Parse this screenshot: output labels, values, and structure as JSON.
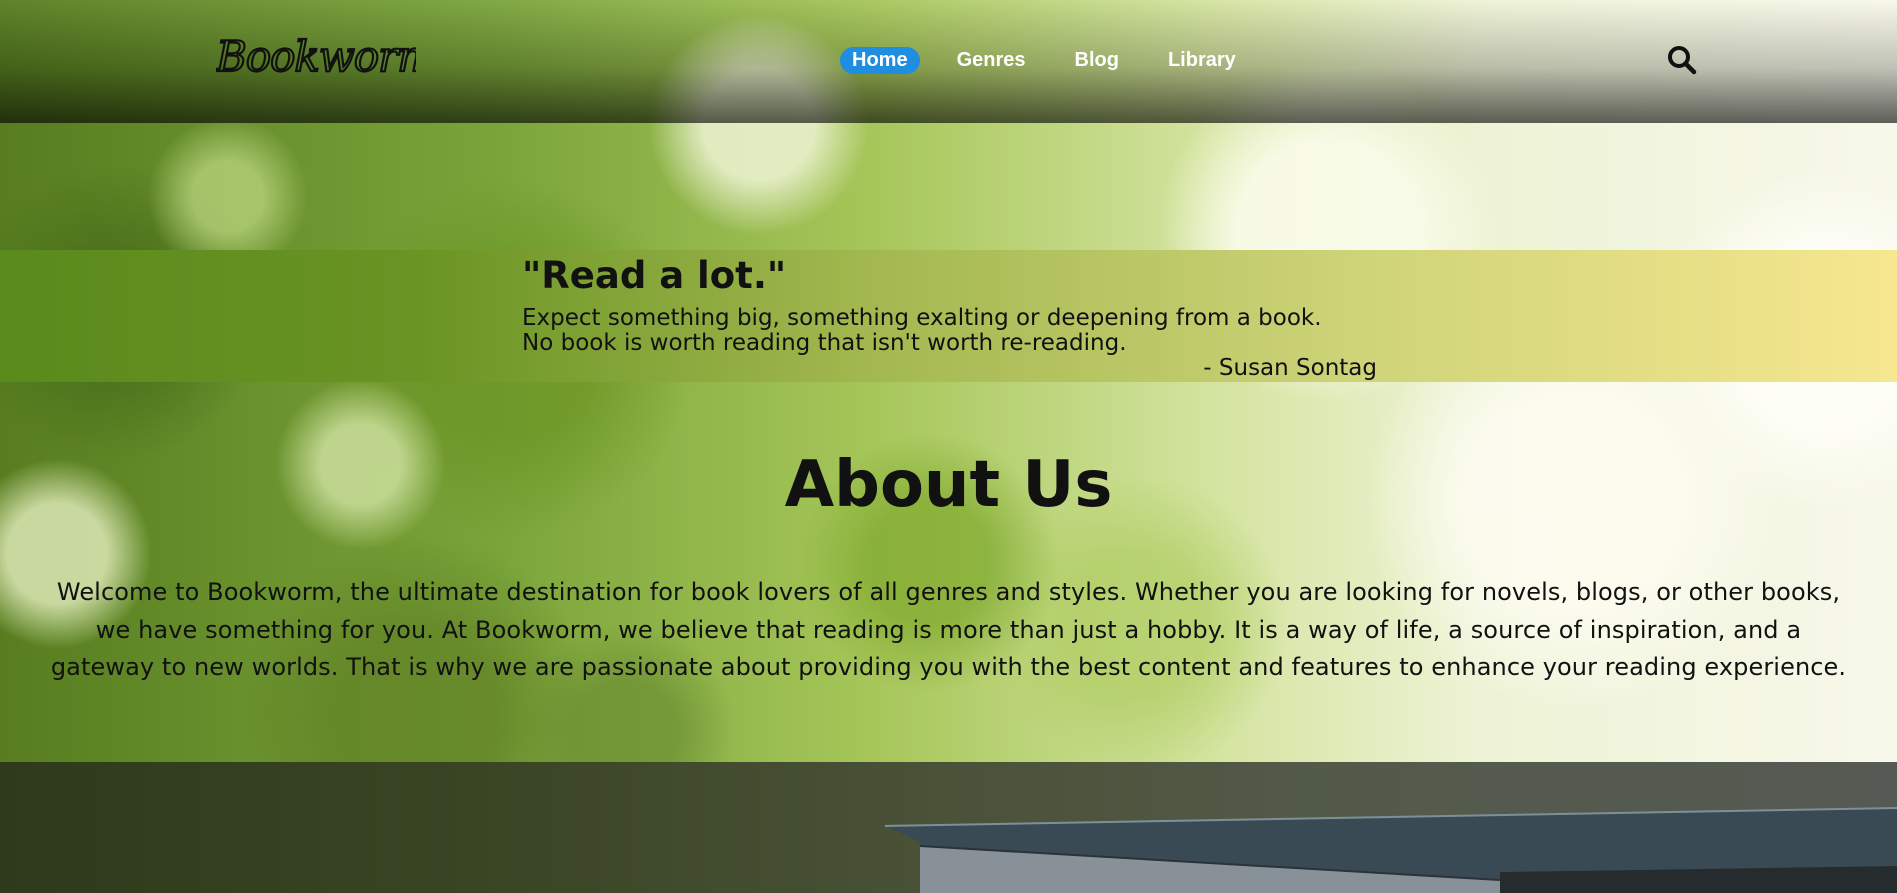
{
  "brand": {
    "logo_text": "Bookworm"
  },
  "nav": {
    "items": [
      {
        "label": "Home",
        "active": true
      },
      {
        "label": "Genres",
        "active": false
      },
      {
        "label": "Blog",
        "active": false
      },
      {
        "label": "Library",
        "active": false
      }
    ]
  },
  "search": {
    "icon": "search-icon"
  },
  "quote": {
    "title": "\"Read a lot.\"",
    "lines": [
      "Expect something big, something exalting or deepening from a book.",
      "No book is worth reading that isn't worth re-reading."
    ],
    "author": "- Susan Sontag"
  },
  "about": {
    "title": "About Us",
    "lines": [
      "Welcome to Bookworm, the ultimate destination for book lovers of all genres and styles. Whether you are looking for novels, blogs, or other books,",
      "we have something for you. At Bookworm, we believe that reading is more than just a hobby. It is a way of life, a source of inspiration, and a",
      "gateway to new worlds. That is why we are passionate about providing you with the best content and features to enhance your reading experience."
    ]
  },
  "colors": {
    "nav_active": "#1f8ee0",
    "nav_text": "#ffffff",
    "quote_band_start": "#5a8a1c",
    "quote_band_end": "#f6e790"
  }
}
